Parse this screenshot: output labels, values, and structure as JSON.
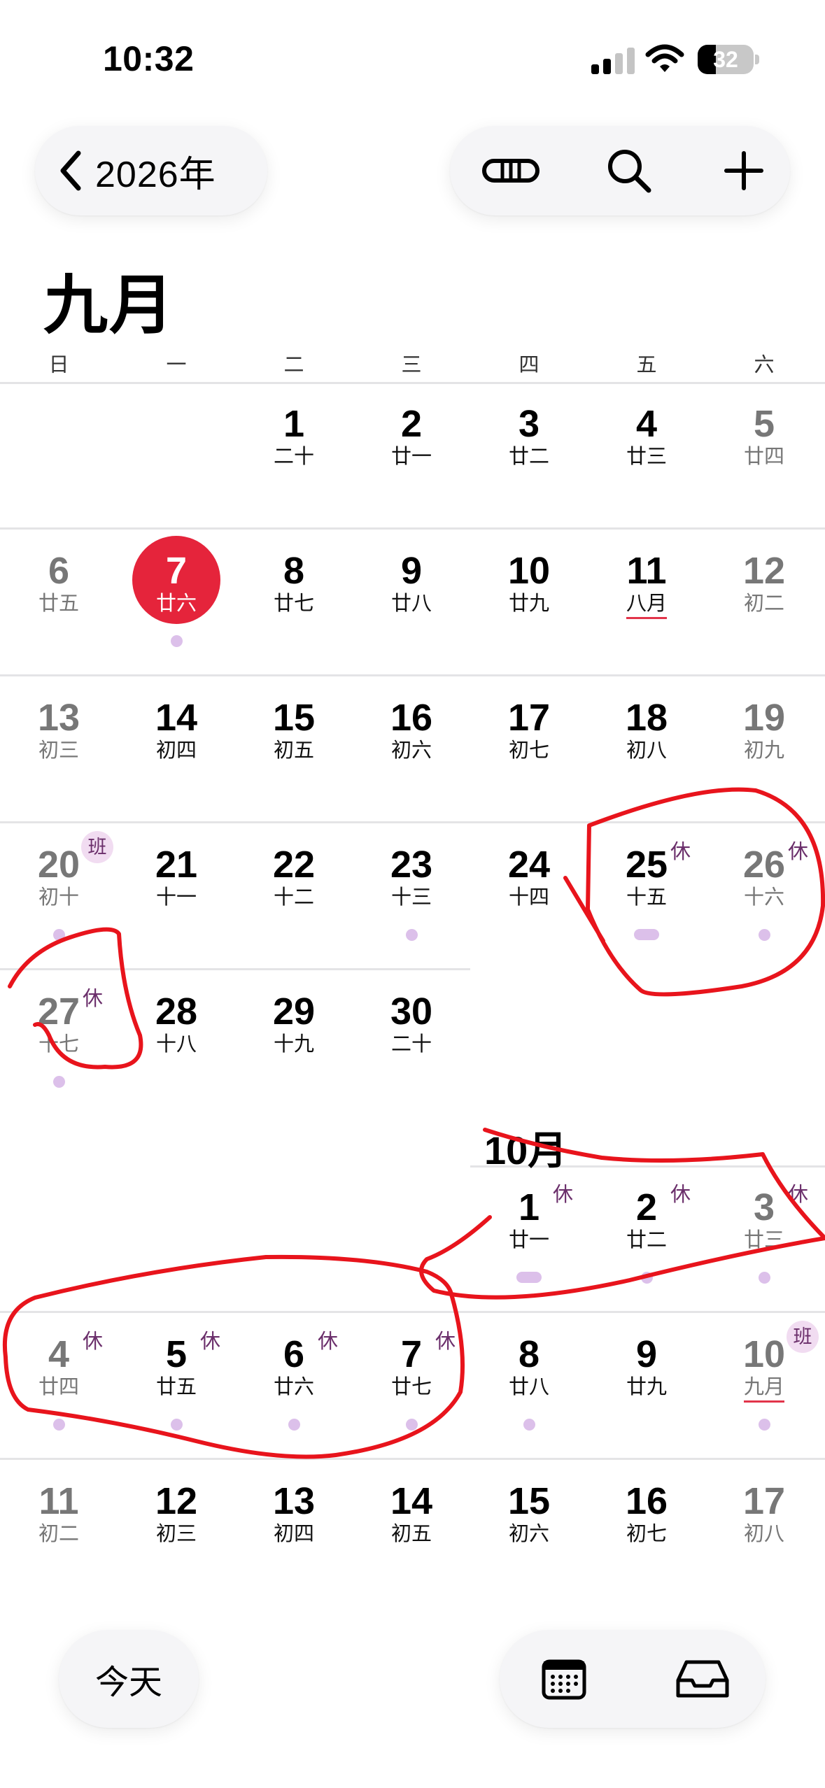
{
  "status_bar": {
    "time": "10:32",
    "battery": "32",
    "battery_level_percent": 32
  },
  "header": {
    "back_label": "2026年",
    "month_title": "九月"
  },
  "weekdays": [
    "日",
    "一",
    "二",
    "三",
    "四",
    "五",
    "六"
  ],
  "september": {
    "rows": [
      [
        null,
        null,
        {
          "num": "1",
          "lunar": "二十"
        },
        {
          "num": "2",
          "lunar": "廿一"
        },
        {
          "num": "3",
          "lunar": "廿二"
        },
        {
          "num": "4",
          "lunar": "廿三"
        },
        {
          "num": "5",
          "lunar": "廿四"
        }
      ],
      [
        {
          "num": "6",
          "lunar": "廿五"
        },
        {
          "num": "7",
          "lunar": "廿六",
          "today": true,
          "dot": true
        },
        {
          "num": "8",
          "lunar": "廿七"
        },
        {
          "num": "9",
          "lunar": "廿八"
        },
        {
          "num": "10",
          "lunar": "廿九"
        },
        {
          "num": "11",
          "lunar": "八月",
          "underline": true
        },
        {
          "num": "12",
          "lunar": "初二"
        }
      ],
      [
        {
          "num": "13",
          "lunar": "初三"
        },
        {
          "num": "14",
          "lunar": "初四"
        },
        {
          "num": "15",
          "lunar": "初五"
        },
        {
          "num": "16",
          "lunar": "初六"
        },
        {
          "num": "17",
          "lunar": "初七"
        },
        {
          "num": "18",
          "lunar": "初八"
        },
        {
          "num": "19",
          "lunar": "初九"
        }
      ],
      [
        {
          "num": "20",
          "lunar": "初十",
          "badge": "班",
          "badge_type": "work",
          "dot": true
        },
        {
          "num": "21",
          "lunar": "十一"
        },
        {
          "num": "22",
          "lunar": "十二"
        },
        {
          "num": "23",
          "lunar": "十三",
          "dot": true
        },
        {
          "num": "24",
          "lunar": "十四"
        },
        {
          "num": "25",
          "lunar": "十五",
          "badge": "休",
          "dot_bar": true
        },
        {
          "num": "26",
          "lunar": "十六",
          "badge": "休",
          "dot": true
        }
      ],
      [
        {
          "num": "27",
          "lunar": "十七",
          "badge": "休",
          "dot": true
        },
        {
          "num": "28",
          "lunar": "十八"
        },
        {
          "num": "29",
          "lunar": "十九"
        },
        {
          "num": "30",
          "lunar": "二十"
        },
        null,
        null,
        null
      ]
    ]
  },
  "october": {
    "label": "10月",
    "rows": [
      [
        null,
        null,
        null,
        null,
        {
          "num": "1",
          "lunar": "廿一",
          "badge": "休",
          "dot_bar": true
        },
        {
          "num": "2",
          "lunar": "廿二",
          "badge": "休",
          "dot": true
        },
        {
          "num": "3",
          "lunar": "廿三",
          "badge": "休",
          "dot": true
        }
      ],
      [
        {
          "num": "4",
          "lunar": "廿四",
          "badge": "休",
          "dot": true
        },
        {
          "num": "5",
          "lunar": "廿五",
          "badge": "休",
          "dot": true
        },
        {
          "num": "6",
          "lunar": "廿六",
          "badge": "休",
          "dot": true
        },
        {
          "num": "7",
          "lunar": "廿七",
          "badge": "休",
          "dot": true
        },
        {
          "num": "8",
          "lunar": "廿八",
          "dot": true
        },
        {
          "num": "9",
          "lunar": "廿九"
        },
        {
          "num": "10",
          "lunar": "九月",
          "badge": "班",
          "badge_type": "work",
          "underline": true,
          "dot": true
        }
      ],
      [
        {
          "num": "11",
          "lunar": "初二"
        },
        {
          "num": "12",
          "lunar": "初三"
        },
        {
          "num": "13",
          "lunar": "初四"
        },
        {
          "num": "14",
          "lunar": "初五"
        },
        {
          "num": "15",
          "lunar": "初六"
        },
        {
          "num": "16",
          "lunar": "初七"
        },
        {
          "num": "17",
          "lunar": "初八"
        }
      ]
    ]
  },
  "bottom_bar": {
    "today_label": "今天"
  },
  "icons": {
    "back": "chevron-left-icon",
    "view_toggle": "capsule-view-icon",
    "search": "search-icon",
    "add": "plus-icon",
    "calendar": "calendar-grid-icon",
    "inbox": "inbox-tray-icon"
  },
  "colors": {
    "accent": "#e5243b",
    "event_dot": "#dcc0ea",
    "badge_text": "#6b2f6b",
    "annotation": "#e8141c"
  }
}
